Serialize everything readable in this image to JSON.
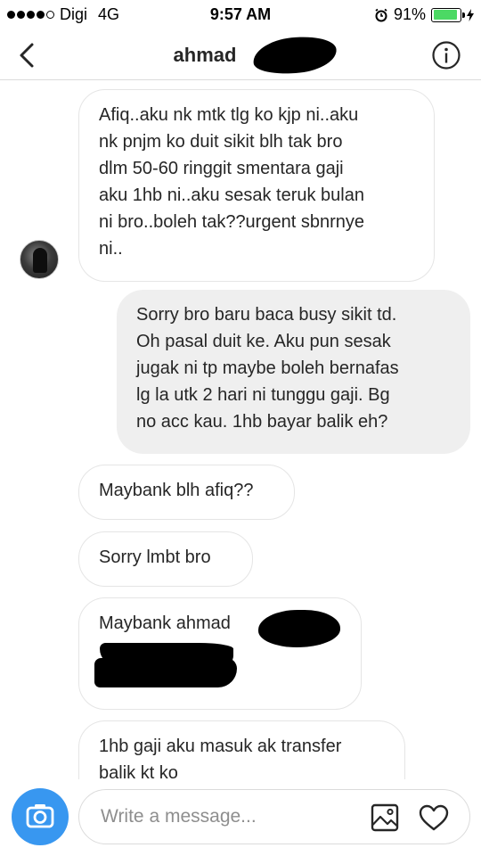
{
  "status_bar": {
    "carrier": "Digi",
    "network": "4G",
    "time": "9:57 AM",
    "battery_percent": "91%",
    "battery_level": 0.91,
    "signal_bars": 4
  },
  "header": {
    "title": "ahmad",
    "back_icon": "chevron-left-icon",
    "info_icon": "info-icon"
  },
  "messages": [
    {
      "direction": "incoming",
      "text": "Afiq..aku nk mtk tlg ko kjp ni..aku\nnk pnjm ko duit sikit blh tak bro\ndlm 50-60 ringgit smentara gaji\naku 1hb ni..aku sesak teruk bulan\nni bro..boleh tak??urgent sbnrnye\nni.."
    },
    {
      "direction": "outgoing",
      "text": "Sorry bro baru baca busy sikit td.\nOh pasal duit ke. Aku pun sesak\njugak ni tp maybe boleh bernafas\nlg la utk 2 hari ni tunggu gaji. Bg\nno acc kau. 1hb bayar balik eh?"
    },
    {
      "direction": "incoming",
      "text": "Maybank blh afiq??"
    },
    {
      "direction": "incoming",
      "text": "Sorry lmbt bro"
    },
    {
      "direction": "incoming",
      "text": "Maybank ahmad"
    },
    {
      "direction": "incoming",
      "text": "1hb gaji aku masuk ak transfer\nbalik kt ko"
    }
  ],
  "composer": {
    "placeholder": "Write a message...",
    "camera_icon": "camera-icon",
    "gallery_icon": "gallery-icon",
    "heart_icon": "heart-icon"
  },
  "colors": {
    "accent": "#3897f0",
    "outgoing_bubble": "#efefef",
    "incoming_border": "#e5e5e5",
    "battery_fill": "#4cd964"
  }
}
